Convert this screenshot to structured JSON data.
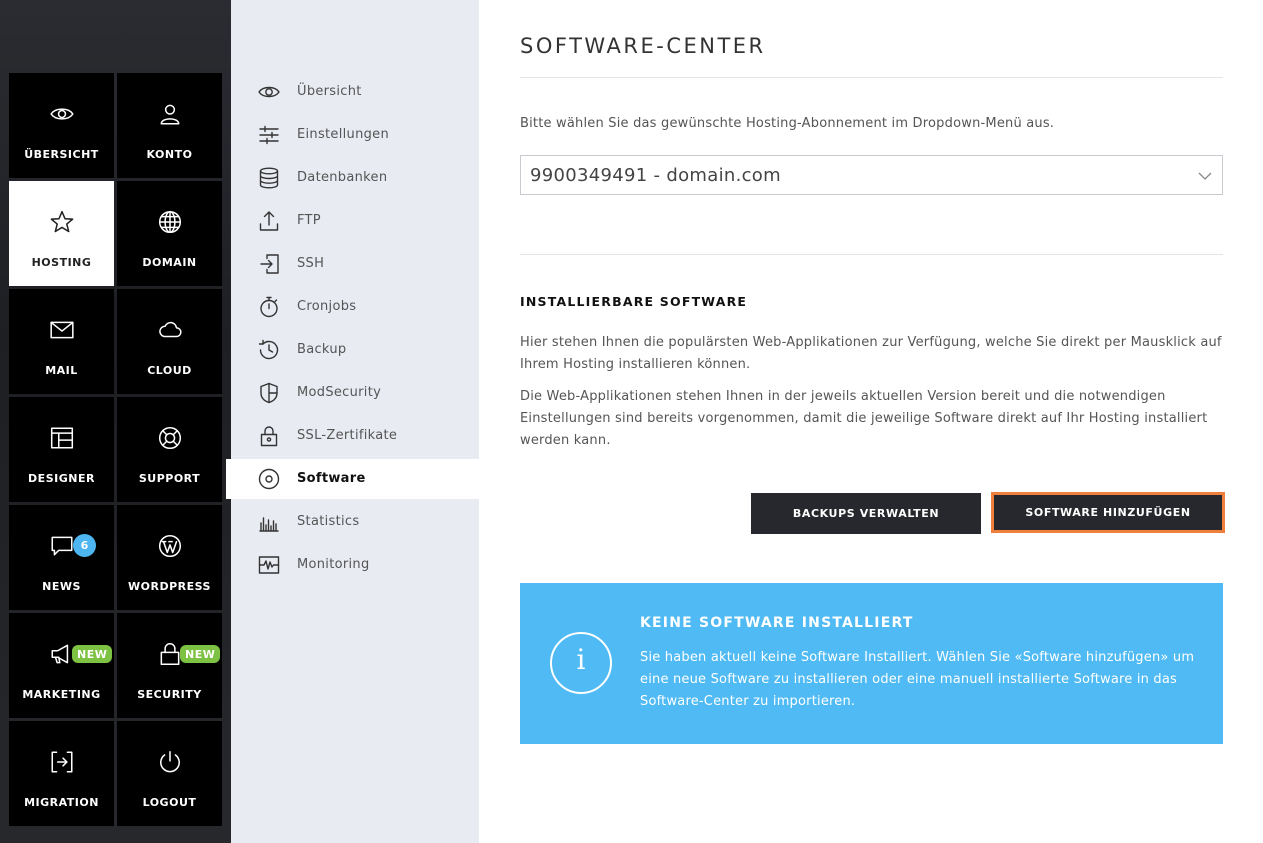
{
  "tiles": [
    {
      "label": "ÜBERSICHT",
      "icon": "eye-icon"
    },
    {
      "label": "KONTO",
      "icon": "user-icon"
    },
    {
      "label": "HOSTING",
      "icon": "star-icon",
      "active": true
    },
    {
      "label": "DOMAIN",
      "icon": "globe-icon"
    },
    {
      "label": "MAIL",
      "icon": "envelope-icon"
    },
    {
      "label": "CLOUD",
      "icon": "cloud-icon"
    },
    {
      "label": "DESIGNER",
      "icon": "layout-icon"
    },
    {
      "label": "SUPPORT",
      "icon": "lifebuoy-icon"
    },
    {
      "label": "NEWS",
      "icon": "chat-bubble-icon",
      "badge": "6"
    },
    {
      "label": "WORDPRESS",
      "icon": "wordpress-icon"
    },
    {
      "label": "MARKETING",
      "icon": "megaphone-icon",
      "badge": "NEW"
    },
    {
      "label": "SECURITY",
      "icon": "lock-icon",
      "badge": "NEW"
    },
    {
      "label": "MIGRATION",
      "icon": "migration-icon"
    },
    {
      "label": "LOGOUT",
      "icon": "power-icon"
    }
  ],
  "subnav": [
    {
      "label": "Übersicht",
      "icon": "eye-icon"
    },
    {
      "label": "Einstellungen",
      "icon": "sliders-icon"
    },
    {
      "label": "Datenbanken",
      "icon": "database-icon"
    },
    {
      "label": "FTP",
      "icon": "upload-icon"
    },
    {
      "label": "SSH",
      "icon": "terminal-login-icon"
    },
    {
      "label": "Cronjobs",
      "icon": "stopwatch-icon"
    },
    {
      "label": "Backup",
      "icon": "history-icon"
    },
    {
      "label": "ModSecurity",
      "icon": "shield-icon"
    },
    {
      "label": "SSL-Zertifikate",
      "icon": "padlock-icon"
    },
    {
      "label": "Software",
      "icon": "disc-icon",
      "active": true
    },
    {
      "label": "Statistics",
      "icon": "bar-chart-icon"
    },
    {
      "label": "Monitoring",
      "icon": "pulse-icon"
    }
  ],
  "main": {
    "title": "SOFTWARE-CENTER",
    "select_hint": "Bitte wählen Sie das gewünschte Hosting-Abonnement im Dropdown-Menü aus.",
    "select_value": "9900349491 - domain.com",
    "section_title": "INSTALLIERBARE SOFTWARE",
    "para1": "Hier stehen Ihnen die populärsten Web-Applikationen zur Verfügung, welche Sie direkt per Mausklick auf Ihrem Hosting installieren können.",
    "para2": "Die Web-Applikationen stehen Ihnen in der jeweils aktuellen Version bereit und die notwendigen Einstellungen sind bereits vorgenommen, damit die jeweilige Software direkt auf Ihr Hosting installiert werden kann.",
    "btn_backups": "BACKUPS VERWALTEN",
    "btn_add": "SOFTWARE HINZUFÜGEN",
    "info_icon": "i",
    "info_title": "KEINE SOFTWARE INSTALLIERT",
    "info_text": "Sie haben aktuell keine Software Installiert. Wählen Sie «Software hinzufügen» um eine neue Software zu installieren oder eine manuell installierte Software in das Software-Center zu importieren."
  },
  "colors": {
    "accent_orange": "#f07f3c",
    "info_blue": "#4fbaf3",
    "badge_blue": "#4db6f0",
    "badge_green": "#7dc242",
    "dark_button": "#26282d",
    "subnav_bg": "#e9ebf3"
  }
}
